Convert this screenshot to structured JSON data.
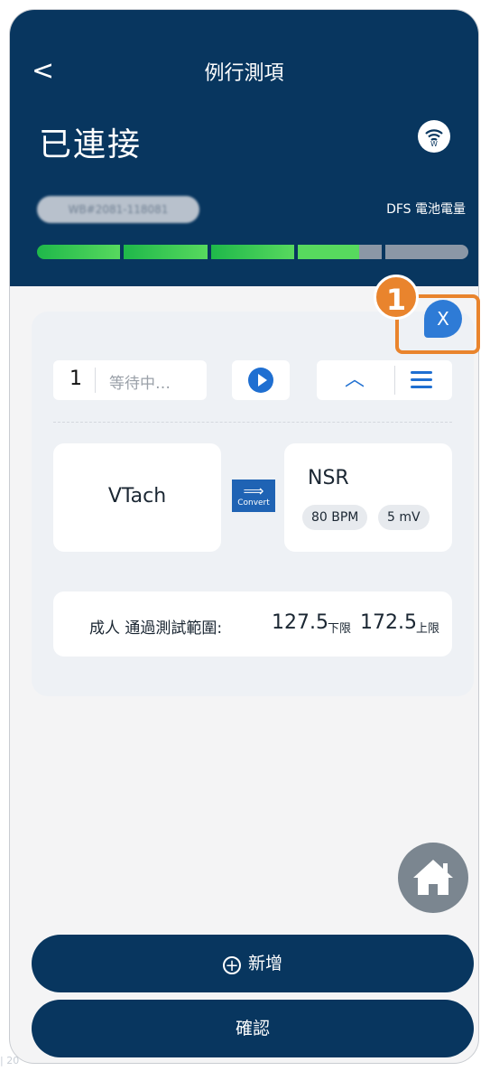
{
  "header": {
    "back_icon": "<",
    "title": "例行測項",
    "status": "已連接",
    "serial_blurred": "WB#2081-118081",
    "battery_label": "DFS 電池電量",
    "battery_level_fraction": 0.86
  },
  "callout": {
    "number": "1",
    "close_label": "X",
    "accent": "#e9842d"
  },
  "test_row": {
    "index": "1",
    "state": "等待中…",
    "up_icon": "chevron-up-icon",
    "menu_icon": "menu-icon",
    "play_icon": "play-icon"
  },
  "conversion": {
    "from": "VTach",
    "convert_label": "Convert",
    "to_name": "NSR",
    "chip1": "80 BPM",
    "chip2": "5 mV"
  },
  "range": {
    "label": "成人 通過測試範圍:",
    "low": "127.5",
    "low_unit": "下限",
    "high": "172.5",
    "high_unit": "上限"
  },
  "buttons": {
    "add": "新增",
    "confirm": "確認"
  },
  "footer": {
    "text": "| 20"
  },
  "colors": {
    "header_bg": "#08365f",
    "accent_blue": "#1f6fd1",
    "battery_green": "#2fc34f"
  }
}
